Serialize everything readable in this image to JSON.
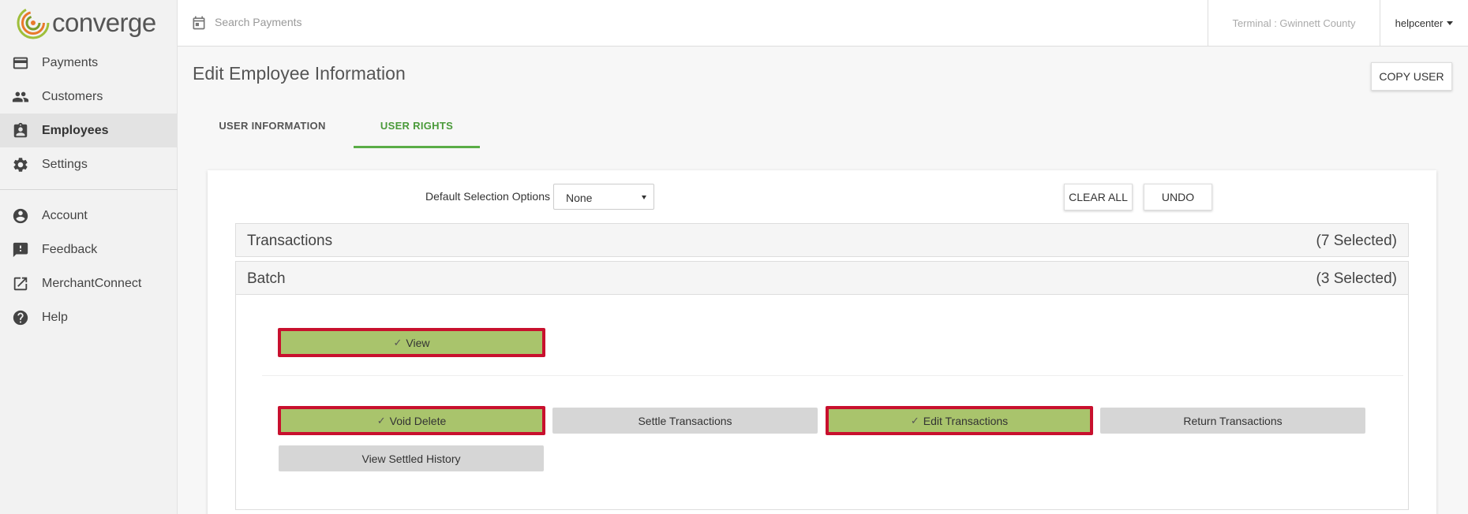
{
  "brand": {
    "name": "converge"
  },
  "sidebar": {
    "primary": [
      {
        "label": "Payments",
        "icon": "credit-card-icon",
        "active": false
      },
      {
        "label": "Customers",
        "icon": "people-icon",
        "active": false
      },
      {
        "label": "Employees",
        "icon": "badge-icon",
        "active": true
      },
      {
        "label": "Settings",
        "icon": "gear-icon",
        "active": false
      }
    ],
    "secondary": [
      {
        "label": "Account",
        "icon": "account-circle-icon"
      },
      {
        "label": "Feedback",
        "icon": "feedback-icon"
      },
      {
        "label": "MerchantConnect",
        "icon": "external-link-icon"
      },
      {
        "label": "Help",
        "icon": "help-icon"
      }
    ]
  },
  "topbar": {
    "search_placeholder": "Search Payments",
    "terminal": "Terminal : Gwinnett County",
    "user": "helpcenter"
  },
  "page": {
    "title": "Edit Employee Information",
    "copy_user_label": "COPY USER",
    "tabs": [
      {
        "label": "USER INFORMATION",
        "active": false
      },
      {
        "label": "USER RIGHTS",
        "active": true
      }
    ]
  },
  "rights": {
    "default_selection_label": "Default Selection Options",
    "default_selection_value": "None",
    "clear_all_label": "CLEAR ALL",
    "undo_label": "UNDO",
    "sections": [
      {
        "title": "Transactions",
        "count": "(7 Selected)"
      },
      {
        "title": "Batch",
        "count": "(3 Selected)"
      }
    ],
    "batch_permissions": [
      {
        "label": "View",
        "selected": true
      },
      {
        "label": "Void Delete",
        "selected": true
      },
      {
        "label": "Settle Transactions",
        "selected": false
      },
      {
        "label": "Edit Transactions",
        "selected": true
      },
      {
        "label": "Return Transactions",
        "selected": false
      },
      {
        "label": "View Settled History",
        "selected": false
      }
    ],
    "check_mark": "✓"
  },
  "colors": {
    "accent_green": "#5aad46",
    "selected_fill": "#a9c46c",
    "highlight_border": "#c8102e",
    "unselected_fill": "#d6d6d6"
  }
}
